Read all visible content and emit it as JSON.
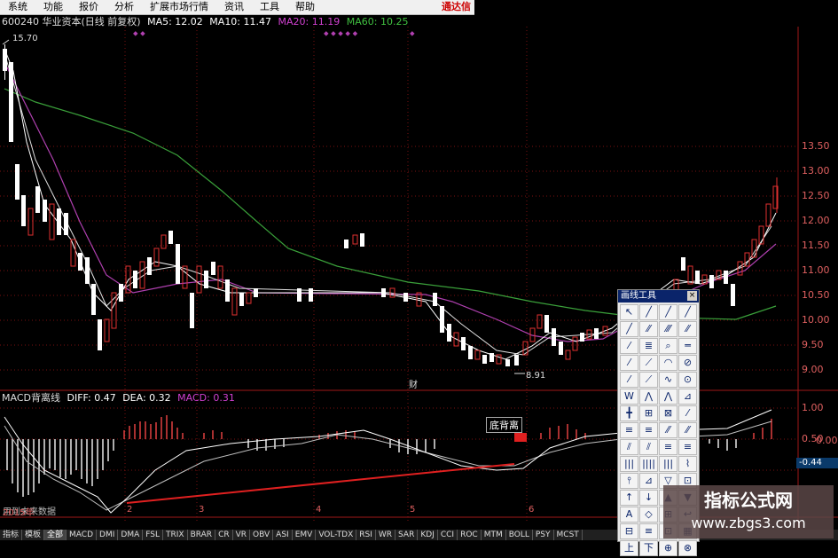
{
  "menubar": {
    "items": [
      "系统",
      "功能",
      "报价",
      "分析",
      "扩展市场行情",
      "资讯",
      "工具",
      "帮助"
    ],
    "brand": "通达信"
  },
  "header": {
    "stock": "600240 华业资本(日线 前复权)",
    "ma5": "MA5: 12.02",
    "ma10": "MA10: 11.47",
    "ma20": "MA20: 11.19",
    "ma60": "MA60: 10.25",
    "colors": {
      "ma5": "#ffffff",
      "ma10": "#ffffff",
      "ma20": "#d040d0",
      "ma60": "#40c040"
    }
  },
  "price_chart": {
    "max_label": "15.70",
    "min_label": "8.91",
    "y_ticks": [
      "13.50",
      "13.00",
      "12.50",
      "12.00",
      "11.50",
      "11.00",
      "10.50",
      "10.00",
      "9.50",
      "9.00"
    ],
    "event_marker": "财"
  },
  "macd": {
    "name": "MACD背离线",
    "diff": "DIFF: 0.47",
    "dea": "DEA: 0.32",
    "macd": "MACD: 0.31",
    "divergence_label": "底背离",
    "y_ticks": [
      "1.00",
      "0.50",
      "0.00"
    ],
    "current_value": "-0.44",
    "note": "用到未来数据"
  },
  "x_axis": {
    "ticks": [
      "2015年",
      "2",
      "3",
      "4",
      "5",
      "6"
    ]
  },
  "drawing_toolbox": {
    "title": "画线工具",
    "close": "×",
    "tools": [
      "↖",
      "╱",
      "╱",
      "╱",
      "╱",
      "⁄⁄",
      "⁄⁄⁄",
      "⁄⁄",
      "⁄",
      "≣",
      "⌕",
      "═",
      "⁄",
      "⟋",
      "◠",
      "⊘",
      "⁄",
      "⟋",
      "∿",
      "⊙",
      "W",
      "⋀",
      "⋀",
      "⊿",
      "╋",
      "⊞",
      "⊠",
      "⁄",
      "≡",
      "≡",
      "⁄⁄",
      "⁄⁄",
      "⫽",
      "⫽",
      "≡",
      "≡",
      "|||",
      "||||",
      "|||",
      "⌇",
      "⫯",
      "⊿",
      "▽",
      "⊡",
      "↑",
      "↓",
      "▲",
      "▼",
      "A",
      "◇",
      "⊞",
      "↩",
      "⊟",
      "≡",
      "⊡",
      "▦",
      "上",
      "下",
      "⊕",
      "⊗"
    ]
  },
  "tabs": [
    "指标",
    "模板",
    "全部",
    "MACD",
    "DMI",
    "DMA",
    "FSL",
    "TRIX",
    "BRAR",
    "CR",
    "VR",
    "OBV",
    "ASI",
    "EMV",
    "VOL-TDX",
    "RSI",
    "WR",
    "SAR",
    "KDJ",
    "CCI",
    "ROC",
    "MTM",
    "BOLL",
    "PSY",
    "MCST"
  ],
  "watermark": {
    "line1": "指标公式网",
    "line2": "www.zbgs3.com"
  }
}
